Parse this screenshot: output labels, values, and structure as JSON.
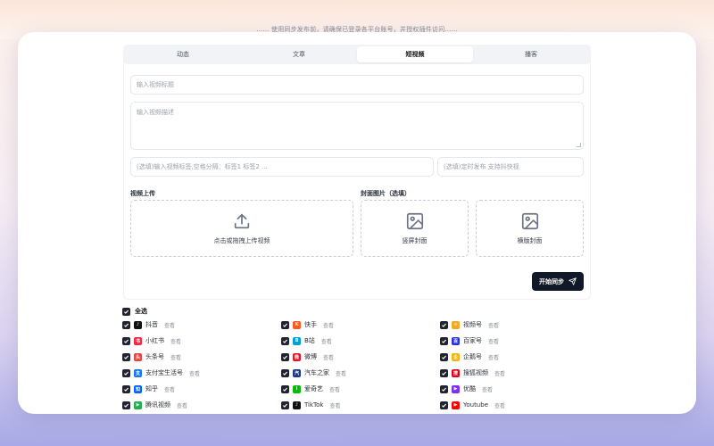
{
  "top_hint": "…… 使用同步发布前，请确保已登录各平台账号，并授权插件访问……",
  "tabs": [
    {
      "label": "动态"
    },
    {
      "label": "文章"
    },
    {
      "label": "短视频"
    },
    {
      "label": "播客"
    }
  ],
  "active_tab": "短视频",
  "form": {
    "title_placeholder": "输入视频标题",
    "desc_placeholder": "输入视频描述",
    "tags_placeholder": "(选填)输入视频标签,空格分隔：标签1 标签2 ...",
    "schedule_placeholder": "(选填)定时发布 支持抖快视"
  },
  "upload": {
    "video_label": "视频上传",
    "cover_label": "封面图片（选填）",
    "video_drop_text": "点击或拖拽上传视频",
    "vertical_cover_text": "竖屏封面",
    "horizontal_cover_text": "横版封面"
  },
  "sync_button": "开始同步",
  "select_all": "全选",
  "view_label": "查看",
  "platforms": [
    {
      "name": "抖音",
      "color": "#111111",
      "glyph": "♪"
    },
    {
      "name": "快手",
      "color": "#ff5a1f",
      "glyph": "K"
    },
    {
      "name": "视频号",
      "color": "#f5a623",
      "glyph": "∞"
    },
    {
      "name": "小红书",
      "color": "#ff2442",
      "glyph": "书"
    },
    {
      "name": "B站",
      "color": "#00a1d6",
      "glyph": "B"
    },
    {
      "name": "百家号",
      "color": "#2932e1",
      "glyph": "百"
    },
    {
      "name": "头条号",
      "color": "#f04142",
      "glyph": "头"
    },
    {
      "name": "微博",
      "color": "#e6162d",
      "glyph": "微"
    },
    {
      "name": "企鹅号",
      "color": "#f7b500",
      "glyph": "企"
    },
    {
      "name": "支付宝生活号",
      "color": "#1677ff",
      "glyph": "支"
    },
    {
      "name": "汽车之家",
      "color": "#1b3a8c",
      "glyph": "汽"
    },
    {
      "name": "搜狐视频",
      "color": "#e60012",
      "glyph": "搜"
    },
    {
      "name": "知乎",
      "color": "#0066ff",
      "glyph": "知"
    },
    {
      "name": "爱奇艺",
      "color": "#00be06",
      "glyph": "i"
    },
    {
      "name": "优酷",
      "color": "#7b2ff7",
      "glyph": "▶"
    },
    {
      "name": "腾讯视频",
      "color": "#20b14a",
      "glyph": "▶"
    },
    {
      "name": "TikTok",
      "color": "#111111",
      "glyph": "♪"
    },
    {
      "name": "Youtube",
      "color": "#ff0000",
      "glyph": "▶"
    }
  ]
}
